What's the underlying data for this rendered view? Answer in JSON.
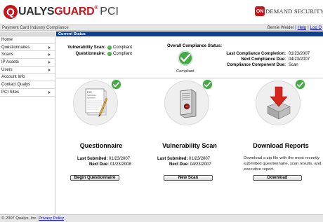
{
  "header": {
    "logo_q": "Q",
    "logo_ualys": "UALYS",
    "logo_guard": "GUARD",
    "logo_reg": "®",
    "logo_pci": "PCI",
    "ods_badge": "ON",
    "ods_text": "DEMAND SECURITY"
  },
  "subbar": {
    "title": "Payment Card Industry Compliance",
    "user": "Bernie Weidel",
    "help": "Help",
    "logout": "Log O",
    "sep": "|"
  },
  "sidebar": {
    "items": [
      {
        "label": "Home",
        "has_arrow": false
      },
      {
        "label": "Questionnaires",
        "has_arrow": true
      },
      {
        "label": "Scans",
        "has_arrow": true
      },
      {
        "label": "IP Assets",
        "has_arrow": true
      },
      {
        "label": "Users",
        "has_arrow": true
      },
      {
        "label": "Account Info",
        "has_arrow": false
      },
      {
        "label": "Contact Qualys",
        "has_arrow": false
      },
      {
        "label": "PCI Sites",
        "has_arrow": true
      }
    ]
  },
  "main": {
    "section_title": "Current Status",
    "status": {
      "vulnerability_scan_label": "Vulnerability Scan:",
      "vulnerability_scan_value": "Compliant",
      "questionnaire_label": "Questionnaire:",
      "questionnaire_value": "Compliant",
      "overall_label": "Overall Compliance Status:",
      "overall_value": "Compliant",
      "last_completion_label": "Last Compliance Completion:",
      "last_completion_value": "01/23/2007",
      "next_due_label": "Next Compliance Due:",
      "next_due_value": "04/23/2007",
      "component_due_label": "Compliance Component Due:",
      "component_due_value": "Scan"
    },
    "panels": {
      "questionnaire": {
        "title": "Questionnaire",
        "doc_lines": [
          "PCI",
          "Self-Asse",
          "Question"
        ],
        "last_label": "Last Submited:",
        "last_value": "01/23/2007",
        "next_label": "Next Due:",
        "next_value": "01/23/2008",
        "button": "Begin Questionnaire"
      },
      "vulnerability_scan": {
        "title": "Vulnerability Scan",
        "last_label": "Last Submited:",
        "last_value": "01/23/2007",
        "next_label": "Next Due:",
        "next_value": "04/23/2007",
        "button": "New Scan"
      },
      "download_reports": {
        "title": "Download Reports",
        "description": "Download a zip file with the most recently submitted questionnaire, scan results, and executive report.",
        "button": "Download"
      }
    }
  },
  "footer": {
    "copyright": "© 2007 Qualys, Inc.",
    "privacy": "Privacy Policy"
  },
  "colors": {
    "brand_red": "#c8141d",
    "nav_blue": "#0d3f8c",
    "ok_green": "#46a846",
    "link_blue": "#0000cc"
  },
  "icons": [
    "check-icon",
    "clipboard-doc-icon",
    "server-icon",
    "download-arrow-icon",
    "chevron-right-icon"
  ]
}
